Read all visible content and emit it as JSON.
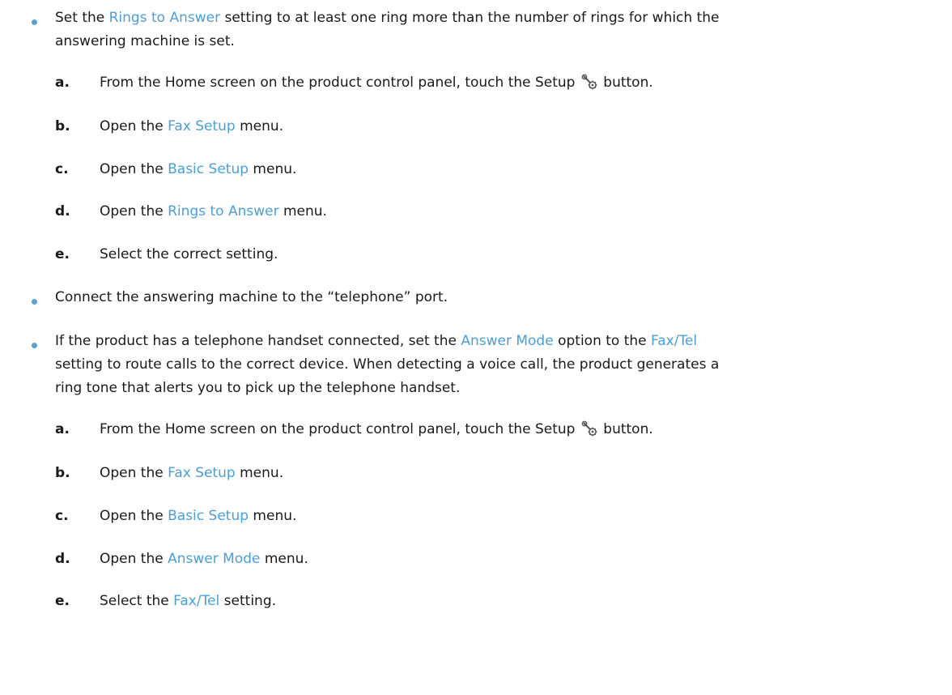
{
  "bullets": [
    {
      "line1_pre": "Set the ",
      "line1_term": "Rings to Answer",
      "line1_post": " setting to at least one ring more than the number of rings for which the",
      "line2": "answering machine is set."
    },
    {
      "text": "Connect the answering machine to the “telephone” port."
    },
    {
      "line1_pre": "If the product has a telephone handset connected, set the ",
      "line1_term1": "Answer Mode",
      "line1_mid": " option to the ",
      "line1_term2": "Fax/Tel",
      "line2": "setting to route calls to the correct device. When detecting a voice call, the product generates a",
      "line3": "ring tone that alerts you to pick up the telephone handset."
    }
  ],
  "steps1": [
    {
      "letter": "a.",
      "pre": "From the Home screen on the product control panel, touch the Setup ",
      "icon": "setup-wrench-gear-icon",
      "post": " button."
    },
    {
      "letter": "b.",
      "pre": "Open the ",
      "term": "Fax Setup",
      "post": " menu."
    },
    {
      "letter": "c.",
      "pre": "Open the ",
      "term": "Basic Setup",
      "post": " menu."
    },
    {
      "letter": "d.",
      "pre": "Open the ",
      "term": "Rings to Answer",
      "post": " menu."
    },
    {
      "letter": "e.",
      "text": "Select the correct setting."
    }
  ],
  "steps2": [
    {
      "letter": "a.",
      "pre": "From the Home screen on the product control panel, touch the Setup ",
      "icon": "setup-wrench-gear-icon",
      "post": " button."
    },
    {
      "letter": "b.",
      "pre": "Open the ",
      "term": "Fax Setup",
      "post": " menu."
    },
    {
      "letter": "c.",
      "pre": "Open the ",
      "term": "Basic Setup",
      "post": " menu."
    },
    {
      "letter": "d.",
      "pre": "Open the ",
      "term": "Answer Mode",
      "post": " menu."
    },
    {
      "letter": "e.",
      "pre": "Select the ",
      "term": "Fax/Tel",
      "post": " setting."
    }
  ],
  "colors": {
    "accent": "#4a9fd8",
    "bullet": "#5aa0d4",
    "text": "#1a1a1a"
  }
}
